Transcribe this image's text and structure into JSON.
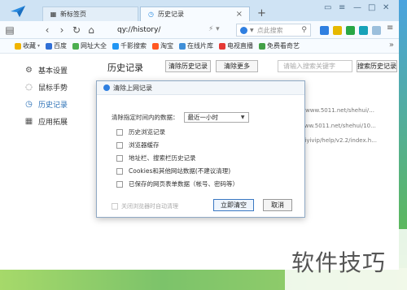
{
  "browser": {
    "tabs": [
      {
        "label": "新标签页",
        "active": false
      },
      {
        "label": "历史记录",
        "active": true
      }
    ],
    "address": "qy://history/",
    "search_placeholder": "点此搜索",
    "bookmarks": [
      {
        "label": "收藏",
        "color": "#f0b400"
      },
      {
        "label": "百度",
        "color": "#2f6fd6"
      },
      {
        "label": "网址大全",
        "color": "#4caf50"
      },
      {
        "label": "千影搜索",
        "color": "#2196f3"
      },
      {
        "label": "淘宝",
        "color": "#ff5722"
      },
      {
        "label": "在线片库",
        "color": "#3f8fd8"
      },
      {
        "label": "电视直播",
        "color": "#e53935"
      },
      {
        "label": "免费看奇艺",
        "color": "#43a047"
      }
    ]
  },
  "sidebar": {
    "items": [
      {
        "label": "基本设置",
        "icon": "gear-icon"
      },
      {
        "label": "鼠标手势",
        "icon": "mouse-icon"
      },
      {
        "label": "历史记录",
        "icon": "clock-icon",
        "active": true
      },
      {
        "label": "应用拓展",
        "icon": "grid-icon"
      }
    ]
  },
  "history": {
    "title": "历史记录",
    "clear_button": "清除历史记录",
    "clear_more_button": "清除更多",
    "search_placeholder": "请输入搜索关键字",
    "search_button": "搜索历史记录",
    "urls": [
      "://www.5011.net/shehui/...",
      "www.5011.net/shehui/10...",
      "iqiyivip/help/v2.2/index.h..."
    ]
  },
  "dialog": {
    "title": "清除上网记录",
    "range_label": "清除指定时间内的数据：",
    "range_value": "最近一小时",
    "options": [
      "历史浏览记录",
      "浏览器缓存",
      "地址栏、搜索栏历史记录",
      "Cookies和其他网站数据(不建议清理)",
      "已保存的网页表单数据（帐号、密码等）"
    ],
    "auto_clean_label": "关闭浏览器时自动清理",
    "confirm_button": "立即清空",
    "cancel_button": "取消"
  },
  "watermark": "软件技巧",
  "colors": {
    "accent": "#2a6fb5",
    "titlebar": "#cfe3f4",
    "desktop": "#3b9ad9"
  }
}
